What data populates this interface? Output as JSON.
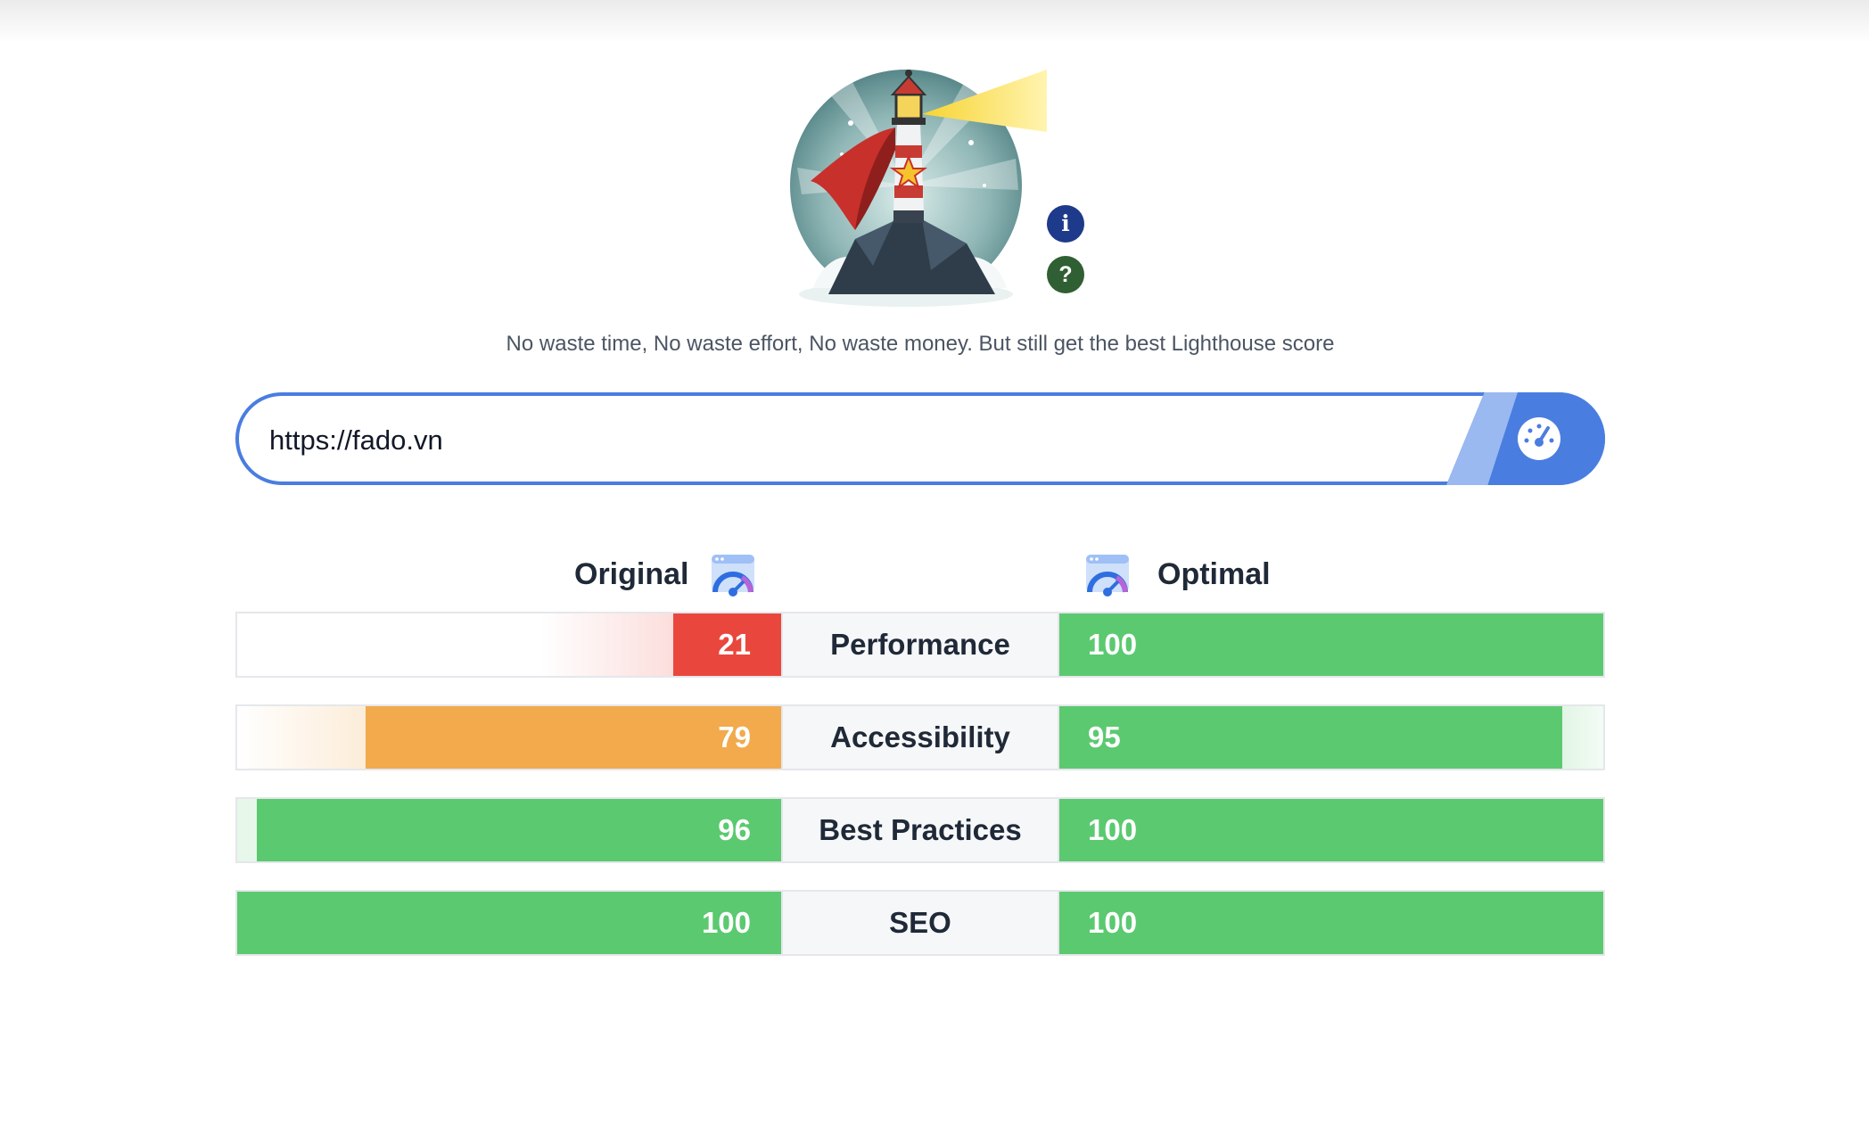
{
  "tagline": "No waste time, No waste effort, No waste money. But still get the best Lighthouse score",
  "search": {
    "value": "https://fado.vn"
  },
  "info_glyph": "i",
  "help_glyph": "?",
  "columns": {
    "original": "Original",
    "optimal": "Optimal"
  },
  "colors": {
    "red": "#e9473d",
    "orange": "#f2aa4c",
    "green": "#5bc970",
    "accent": "#4a7de0"
  },
  "icons": [
    "lighthouse-logo",
    "info-icon",
    "help-icon",
    "speedometer-icon",
    "pagespeed-icon"
  ],
  "metrics": [
    {
      "label": "Performance",
      "original": "21",
      "optimal": "100"
    },
    {
      "label": "Accessibility",
      "original": "79",
      "optimal": "95"
    },
    {
      "label": "Best Practices",
      "original": "96",
      "optimal": "100"
    },
    {
      "label": "SEO",
      "original": "100",
      "optimal": "100"
    }
  ]
}
